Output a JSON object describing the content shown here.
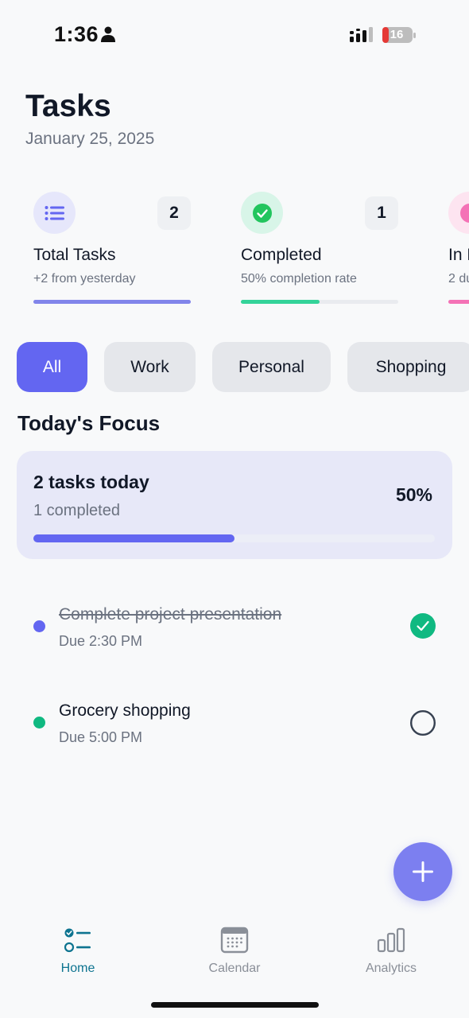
{
  "status_bar": {
    "time": "1:36",
    "battery": "16"
  },
  "header": {
    "title": "Tasks",
    "date": "January 25, 2025"
  },
  "stats": [
    {
      "icon": "list-icon",
      "count": "2",
      "label": "Total Tasks",
      "sub": "+2 from yesterday",
      "progress": 1.0,
      "color": "#8185ea",
      "icon_bg": "#e6e7fb"
    },
    {
      "icon": "check-circle-icon",
      "count": "1",
      "label": "Completed",
      "sub": "50% completion rate",
      "progress": 0.5,
      "color": "#34d399",
      "icon_bg": "#d8f5e8"
    },
    {
      "icon": "progress-icon",
      "count": "",
      "label": "In P",
      "sub": "2 du",
      "progress": 1.0,
      "color": "#f472b6",
      "icon_bg": "#fde4f0"
    }
  ],
  "categories": [
    "All",
    "Work",
    "Personal",
    "Shopping"
  ],
  "active_category": "All",
  "focus": {
    "section_title": "Today's Focus",
    "title": "2 tasks today",
    "subtitle": "1 completed",
    "percent_label": "50%",
    "progress": 0.5
  },
  "tasks": [
    {
      "title": "Complete project presentation",
      "due": "Due 2:30 PM",
      "completed": true,
      "dot_color": "#6366f1"
    },
    {
      "title": "Grocery shopping",
      "due": "Due 5:00 PM",
      "completed": false,
      "dot_color": "#10b981"
    }
  ],
  "nav": [
    {
      "label": "Home",
      "icon": "home-tasks-icon",
      "active": true
    },
    {
      "label": "Calendar",
      "icon": "calendar-icon",
      "active": false
    },
    {
      "label": "Analytics",
      "icon": "analytics-icon",
      "active": false
    }
  ],
  "colors": {
    "accent": "#6366f1",
    "success": "#10b981",
    "nav_active": "#0e7490"
  }
}
